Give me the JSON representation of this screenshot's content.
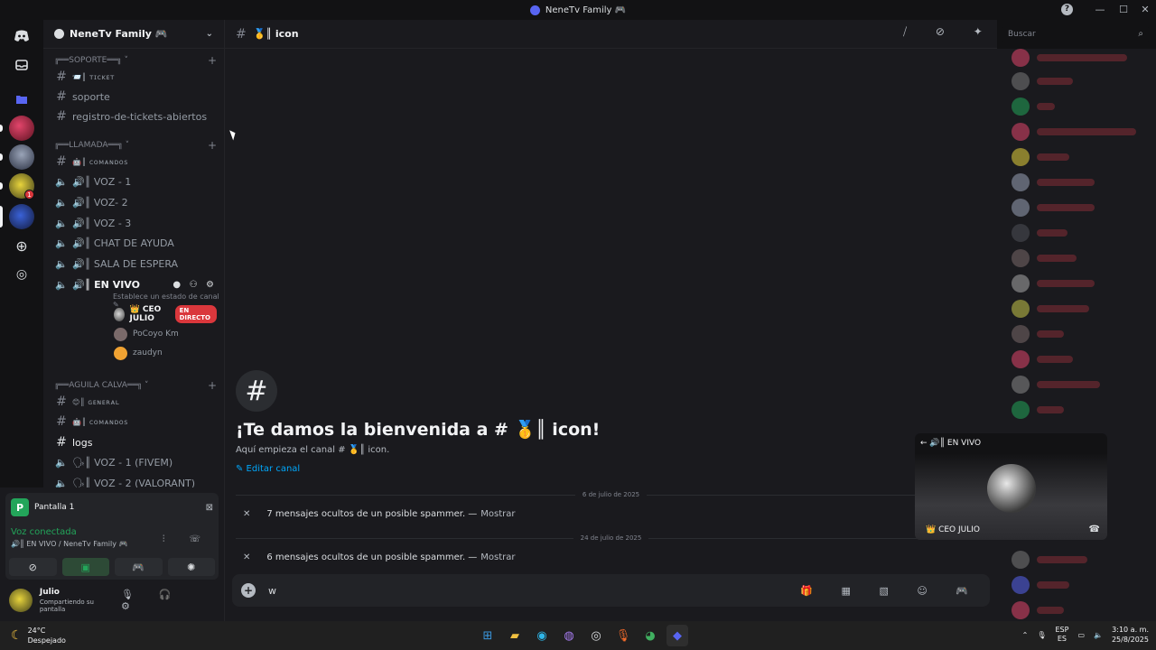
{
  "window": {
    "title": "NeneTv Family 🎮",
    "help_icon": "question-icon",
    "controls": [
      "—",
      "☐",
      "✕"
    ]
  },
  "server_rail": {
    "home_icon": "discord-logo-icon",
    "inbox_icon": "inbox-icon",
    "folder_icon": "folder-icon",
    "badge_count": "1",
    "add_icon": "plus-circle-icon",
    "discover_icon": "compass-icon"
  },
  "guild": {
    "name": "NeneTv Family 🎮"
  },
  "channels": {
    "cat_soporte": "╔══SOPORTE══╗ ˅",
    "ticket": "📨║ ᴛɪᴄᴋᴇᴛ",
    "soporte": "soporte",
    "registro": "registro-de-tickets-abiertos",
    "cat_llamada": "╔══LLAMADA══╗ ˅",
    "comandos1": "🤖║ ᴄᴏᴍᴀɴᴅᴏs",
    "voz1": "🔊║ VOZ - 1",
    "voz2": "🔊║ VOZ- 2",
    "voz3": "🔊║ VOZ - 3",
    "chat_ayuda": "🔊║ CHAT DE AYUDA",
    "sala_espera": "🔊║ SALA DE ESPERA",
    "en_vivo": "🔊║ EN VIVO",
    "status_hint": "Establece un estado de canal ✎",
    "user_ceo": "👑 CEO JULIO",
    "live_badge": "EN DIRECTO",
    "user_pocoyo": "PoCoyo Km",
    "user_zaudyn": "zaudyn",
    "cat_aguila": "╔══AGUILA CALVA══╗ ˅",
    "general": "😊║ ɢᴇɴᴇʀᴀʟ",
    "comandos2": "🤖║ ᴄᴏᴍᴀɴᴅᴏs",
    "logs": "logs",
    "voz_fivem": "🗣║ VOZ - 1 (FIVEM)",
    "voz_valorant": "🗣║ VOZ - 2 (VALORANT)"
  },
  "voice_panel": {
    "screen_label": "Pantalla 1",
    "connected": "Voz conectada",
    "location": "🔊║ EN VIVO / NeneTv Family 🎮",
    "user_name": "Julio",
    "user_status": "Compartiendo su pantalla"
  },
  "channel_header": {
    "title": "🥇║ icon",
    "search_placeholder": "Buscar"
  },
  "welcome": {
    "title": "¡Te damos la bienvenida a # 🥇║ icon!",
    "subtitle": "Aquí empieza el canal # 🥇║ icon.",
    "edit": "✎  Editar canal"
  },
  "messages": {
    "date1": "6 de julio de 2025",
    "hidden1": "7 mensajes ocultos de un posible spammer. —",
    "show1": "Mostrar",
    "date2": "24 de julio de 2025",
    "hidden2": "6 mensajes ocultos de un posible spammer. —",
    "show2": "Mostrar"
  },
  "composer": {
    "value": "w"
  },
  "pip": {
    "title": "← 🔊║ EN VIVO",
    "name": "👑 CEO JULIO"
  },
  "taskbar": {
    "temp": "24°C",
    "weather": "Despejado",
    "lang1": "ESP",
    "lang2": "ES",
    "time": "3:10 a. m.",
    "date": "25/8/2025"
  },
  "colors": {
    "accent": "#5865f2",
    "online": "#23a55a",
    "live": "#da373c",
    "link": "#00a8fc"
  }
}
